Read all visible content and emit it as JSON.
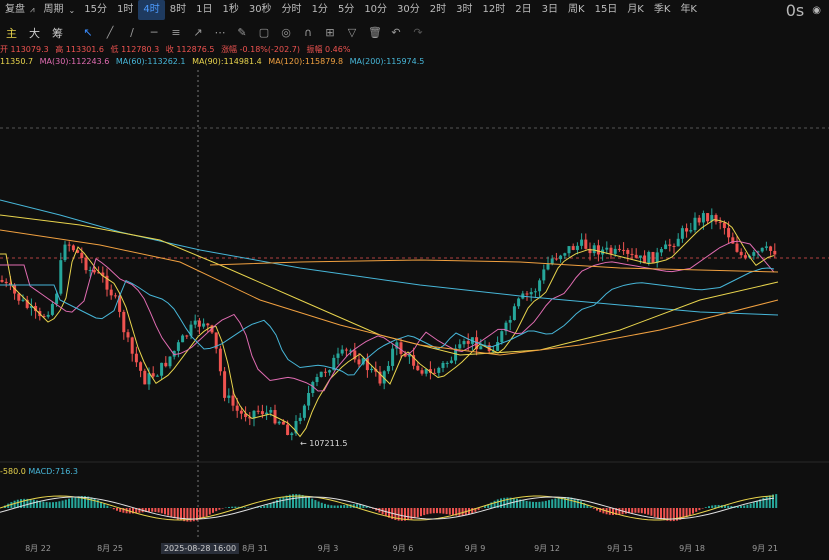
{
  "toolbar": {
    "left": [
      "复盘",
      "周期",
      "15分",
      "1时",
      "4时",
      "8时",
      "1日",
      "1秒",
      "30秒",
      "分时",
      "1分",
      "5分",
      "10分",
      "30分",
      "2时",
      "3时",
      "12时",
      "2日",
      "3日",
      "周K",
      "15日",
      "月K",
      "季K",
      "年K"
    ],
    "active": "4时",
    "right_label": "0s"
  },
  "toolbar2": [
    "主",
    "大",
    "筹"
  ],
  "ohlc": {
    "open": "开 113079.3",
    "high": "高 113301.6",
    "low": "低 112780.3",
    "close": "收 112876.5",
    "change": "涨幅 -0.18%(-202.7)",
    "amplitude": "振幅 0.46%"
  },
  "ma": {
    "ma_first": "11350.7",
    "ma30": "MA(30):112243.6",
    "ma60": "MA(60):113262.1",
    "ma90": "MA(90):114981.4",
    "ma120": "MA(120):115879.8",
    "ma200": "MA(200):115974.5"
  },
  "low_marker": "107211.5",
  "macd": {
    "first": "-580.0",
    "macd": "MACD:716.3"
  },
  "xaxis": [
    "8月 22",
    "8月 25",
    "2025-08-28 16:00",
    "8月 31",
    "9月 3",
    "9月 6",
    "9月 9",
    "9月 12",
    "9月 15",
    "9月 18",
    "9月 21"
  ],
  "colors": {
    "up": "#26a69a",
    "down": "#ef5350",
    "ma_yellow": "#e8d44d",
    "ma_pink": "#e06cb2",
    "ma_cyan": "#47b6d8",
    "ma_orange": "#f0a040"
  }
}
